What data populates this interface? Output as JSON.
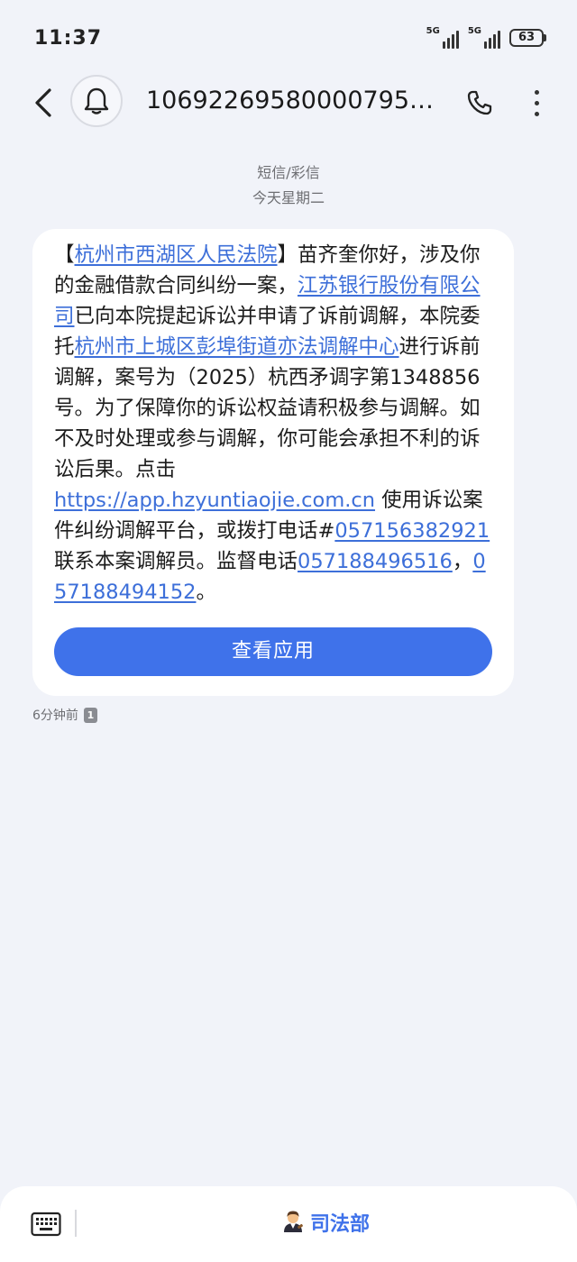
{
  "status_bar": {
    "time": "11:37",
    "network_1": "5G",
    "network_2": "5G",
    "battery": "63"
  },
  "header": {
    "title": "10692269580000795…"
  },
  "meta": {
    "channel": "短信/彩信",
    "date": "今天星期二"
  },
  "message": {
    "p1": "【",
    "court_link": "杭州市西湖区人民法院",
    "p2": "】苗齐奎你好，涉及你的金融借款合同纠纷一案，",
    "bank_link": "江苏银行股份有限公司",
    "p3": "已向本院提起诉讼并申请了诉前调解，本院委托",
    "center_link": "杭州市上城区彭埠街道亦法调解中心",
    "p4": "进行诉前调解，案号为（2025）杭西矛调字第1348856号。为了保障你的诉讼权益请积极参与调解。如不及时处理或参与调解，你可能会承担不利的诉讼后果。点击",
    "url_link": "https://app.hzyuntiaojie.com.cn",
    "p5": " 使用诉讼案件纠纷调解平台，或拨打电话#",
    "phone1_link": "057156382921",
    "p6": "联系本案调解员。监督电话",
    "phone2_link": "057188496516",
    "p7": "，",
    "phone3_link": "057188494152",
    "p8": "。",
    "button_label": "查看应用",
    "time_ago": "6分钟前",
    "sim": "1"
  },
  "bottom_bar": {
    "menu_label": "司法部"
  },
  "colors": {
    "accent": "#3f72ea",
    "link": "#3d6fd9",
    "background": "#f1f3f9"
  },
  "icons": [
    "back-arrow-icon",
    "bell-icon",
    "phone-icon",
    "more-vertical-icon",
    "keyboard-icon",
    "judge-emoji-icon"
  ]
}
